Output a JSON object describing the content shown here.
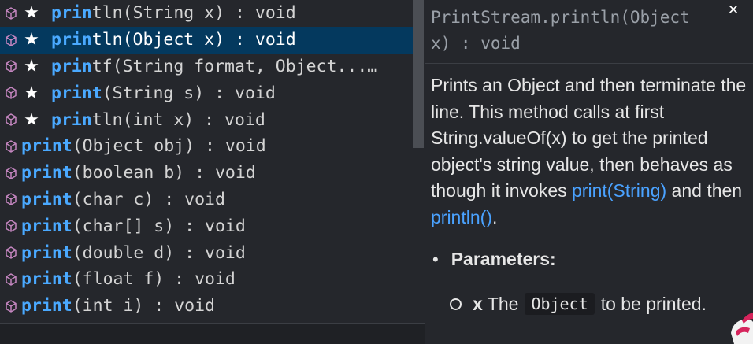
{
  "suggestions": {
    "items": [
      {
        "highlight": "prin",
        "rest": "tln(String x) : void",
        "starred": true,
        "selected": false
      },
      {
        "highlight": "prin",
        "rest": "tln(Object x) : void",
        "starred": true,
        "selected": true
      },
      {
        "highlight": "prin",
        "rest": "tf(String format, Object...…",
        "starred": true,
        "selected": false
      },
      {
        "highlight": "print",
        "rest": "(String s) : void",
        "starred": true,
        "selected": false
      },
      {
        "highlight": "prin",
        "rest": "tln(int x) : void",
        "starred": true,
        "selected": false
      },
      {
        "highlight": "print",
        "rest": "(Object obj) : void",
        "starred": false,
        "selected": false
      },
      {
        "highlight": "print",
        "rest": "(boolean b) : void",
        "starred": false,
        "selected": false
      },
      {
        "highlight": "print",
        "rest": "(char c) : void",
        "starred": false,
        "selected": false
      },
      {
        "highlight": "print",
        "rest": "(char[] s) : void",
        "starred": false,
        "selected": false
      },
      {
        "highlight": "print",
        "rest": "(double d) : void",
        "starred": false,
        "selected": false
      },
      {
        "highlight": "print",
        "rest": "(float f) : void",
        "starred": false,
        "selected": false
      },
      {
        "highlight": "print",
        "rest": "(int i) : void",
        "starred": false,
        "selected": false
      }
    ],
    "star_glyph": "★",
    "item_icon": "method-cube-icon"
  },
  "docs": {
    "signature": "PrintStream.println(Object x) : void",
    "close_glyph": "✕",
    "description_before": "Prints an Object and then terminate the line. This method calls at first String.valueOf(x) to get the printed object's string value, then behaves as though it invokes ",
    "link1": "print(String)",
    "description_middle": " and then ",
    "link2": "println()",
    "description_after": ".",
    "params_bullet": "•",
    "params_label": "Parameters:",
    "param": {
      "name": "x",
      "text_before": "The",
      "code": "Object",
      "text_after": "to be printed."
    }
  },
  "colors": {
    "background": "#25272c",
    "selected_row": "#04395e",
    "match_highlight": "#4aa9ff",
    "link": "#4aa2ff",
    "icon": "#c586c0"
  }
}
